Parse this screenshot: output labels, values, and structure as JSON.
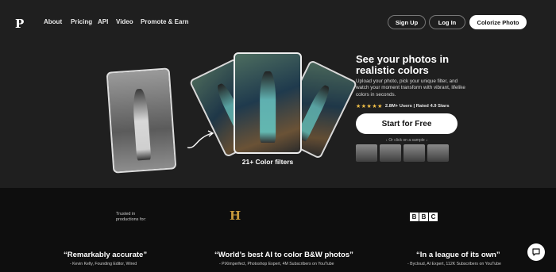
{
  "nav": {
    "logo": "P",
    "links": [
      "About",
      "Pricing",
      "API",
      "Video",
      "Promote & Earn"
    ],
    "signup": "Sign Up",
    "login": "Log In",
    "colorize": "Colorize Photo"
  },
  "hero": {
    "filters_label": "21+ Color filters",
    "headline": "See your photos in realistic colors",
    "subtext": "Upload your photo, pick your unique filter, and watch your moment transform with vibrant, lifelike colors in seconds.",
    "stars": "★★★★★",
    "rating_text": "2.8M+ Users | Rated 4.9 Stars",
    "cta": "Start for Free",
    "sample_hint": "↓ Or click on a sample ↓"
  },
  "trusted": {
    "label": "Trusted in productions for:",
    "logo_h": "H",
    "logo_bbc": [
      "B",
      "B",
      "C"
    ]
  },
  "quotes": [
    {
      "text": "“Remarkably accurate”",
      "attribution": "- Kevin Kelly, Founding Editor, Wired"
    },
    {
      "text": "“World’s best AI to color B&W photos”",
      "attribution": "- PiXimperfect, Photoshop Expert, 4M Subscribers on YouTube"
    },
    {
      "text": "“In a league of its own”",
      "attribution": "- Bycloud, AI Expert, 112K Subscribers on YouTube"
    }
  ],
  "colors": {
    "star": "#f3c048",
    "background": "#1f1f1f"
  }
}
